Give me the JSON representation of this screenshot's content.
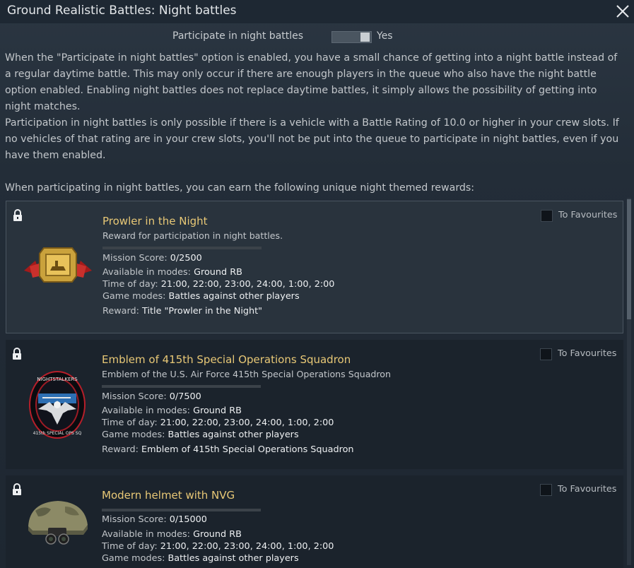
{
  "window": {
    "title": "Ground Realistic Battles: Night battles"
  },
  "toggle": {
    "label": "Participate in night battles",
    "value": "Yes",
    "enabled": true
  },
  "intro": {
    "p1": "When the \"Participate in night battles\" option is enabled, you have a small chance of getting into a night battle instead of a regular daytime battle. This may only occur if there are enough players in the queue who also have the night battle option enabled. Enabling night battles does not replace daytime battles, it simply allows the possibility of getting into night matches.",
    "p2": "Participation in night battles is only possible if there is a vehicle with a Battle Rating of 10.0 or higher in your crew slots. If no vehicles of that rating are in your crew slots, you'll not be put into the queue to participate in night battles, even if you have them enabled.",
    "p3": "When participating in night battles, you can earn the following unique night themed rewards:"
  },
  "labels": {
    "mission_score": "Mission Score: ",
    "available": "Available in modes: ",
    "time": "Time of day: ",
    "game_modes": "Game modes: ",
    "reward": "Reward: ",
    "favourites": "To Favourites"
  },
  "rewards": [
    {
      "title": "Prowler in the Night",
      "description": "Reward for participation in night battles.",
      "score": "0/2500",
      "progress": 0,
      "modes": "Ground RB",
      "time": "21:00, 22:00, 23:00, 24:00, 1:00, 2:00",
      "game_modes": "Battles against other players",
      "reward": "Title \"Prowler in the Night\""
    },
    {
      "title": "Emblem of 415th Special Operations Squadron",
      "description": "Emblem of the U.S. Air Force 415th Special Operations Squadron",
      "score": "0/7500",
      "progress": 0,
      "modes": "Ground RB",
      "time": "21:00, 22:00, 23:00, 24:00, 1:00, 2:00",
      "game_modes": "Battles against other players",
      "reward": "Emblem of 415th Special Operations Squadron",
      "emblem_top_text": "NIGHTSTALKERS",
      "emblem_bottom_text": "415th SPECIAL OPS SQ"
    },
    {
      "title": "Modern helmet with NVG",
      "score": "0/15000",
      "progress": 0,
      "modes": "Ground RB",
      "time": "21:00, 22:00, 23:00, 24:00, 1:00, 2:00",
      "game_modes": "Battles against other players"
    }
  ],
  "colors": {
    "accent_title": "#e8c876",
    "progress_fill": "#705d34"
  }
}
